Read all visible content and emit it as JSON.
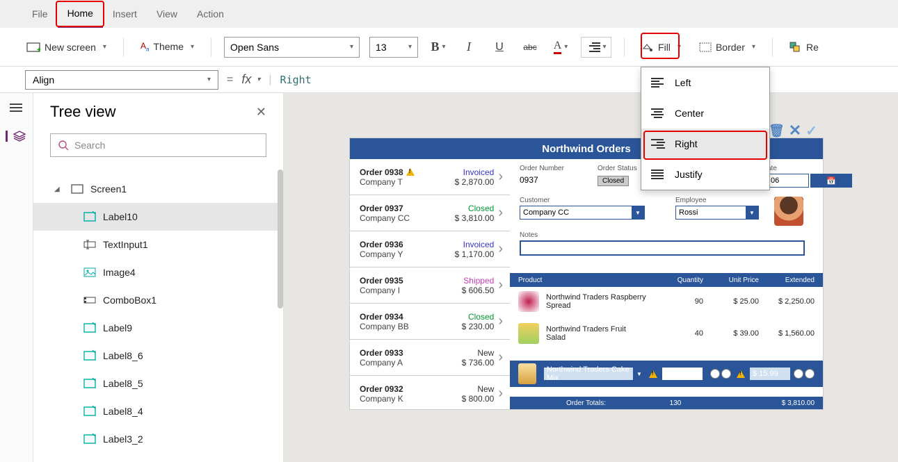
{
  "menu": {
    "file": "File",
    "home": "Home",
    "insert": "Insert",
    "view": "View",
    "action": "Action"
  },
  "ribbon": {
    "new_screen": "New screen",
    "theme": "Theme",
    "font": "Open Sans",
    "fontsize": "13",
    "fill": "Fill",
    "border": "Border",
    "reorder": "Re"
  },
  "formula": {
    "property": "Align",
    "eq": "=",
    "fx": "fx",
    "value": "Right"
  },
  "tree": {
    "title": "Tree view",
    "search_placeholder": "Search",
    "root": "Screen1",
    "items": [
      "Label10",
      "TextInput1",
      "Image4",
      "ComboBox1",
      "Label9",
      "Label8_6",
      "Label8_5",
      "Label8_4",
      "Label3_2"
    ],
    "selected": "Label10"
  },
  "align_menu": {
    "left": "Left",
    "center": "Center",
    "right": "Right",
    "justify": "Justify",
    "selected": "Right"
  },
  "app": {
    "title": "Northwind Orders",
    "orders": [
      {
        "id": "Order 0938",
        "company": "Company T",
        "status": "Invoiced",
        "status_class": "invoiced",
        "amount": "$ 2,870.00",
        "warn": true
      },
      {
        "id": "Order 0937",
        "company": "Company CC",
        "status": "Closed",
        "status_class": "closed",
        "amount": "$ 3,810.00"
      },
      {
        "id": "Order 0936",
        "company": "Company Y",
        "status": "Invoiced",
        "status_class": "invoiced",
        "amount": "$ 1,170.00"
      },
      {
        "id": "Order 0935",
        "company": "Company I",
        "status": "Shipped",
        "status_class": "shipped",
        "amount": "$ 606.50"
      },
      {
        "id": "Order 0934",
        "company": "Company BB",
        "status": "Closed",
        "status_class": "closed",
        "amount": "$ 230.00"
      },
      {
        "id": "Order 0933",
        "company": "Company A",
        "status": "New",
        "status_class": "new",
        "amount": "$ 736.00"
      },
      {
        "id": "Order 0932",
        "company": "Company K",
        "status": "New",
        "status_class": "new",
        "amount": "$ 800.00"
      }
    ],
    "detail": {
      "labels": {
        "order_number": "Order Number",
        "order_status": "Order Status",
        "date": "ate",
        "customer": "Customer",
        "employee": "Employee",
        "notes": "Notes"
      },
      "order_number": "0937",
      "order_status": "Closed",
      "date": "06",
      "customer": "Company CC",
      "employee": "Rossi",
      "notes": ""
    },
    "lines": {
      "headers": {
        "product": "Product",
        "qty": "Quantity",
        "unit": "Unit Price",
        "ext": "Extended"
      },
      "rows": [
        {
          "name": "Northwind Traders Raspberry Spread",
          "qty": "90",
          "unit": "$ 25.00",
          "ext": "$ 2,250.00"
        },
        {
          "name": "Northwind Traders Fruit Salad",
          "qty": "40",
          "unit": "$ 39.00",
          "ext": "$ 1,560.00"
        }
      ],
      "new_row": {
        "name": "Northwind Traders Cake Mix",
        "price": "$ 15.99"
      },
      "totals": {
        "label": "Order Totals:",
        "qty": "130",
        "ext": "$ 3,810.00"
      }
    }
  }
}
